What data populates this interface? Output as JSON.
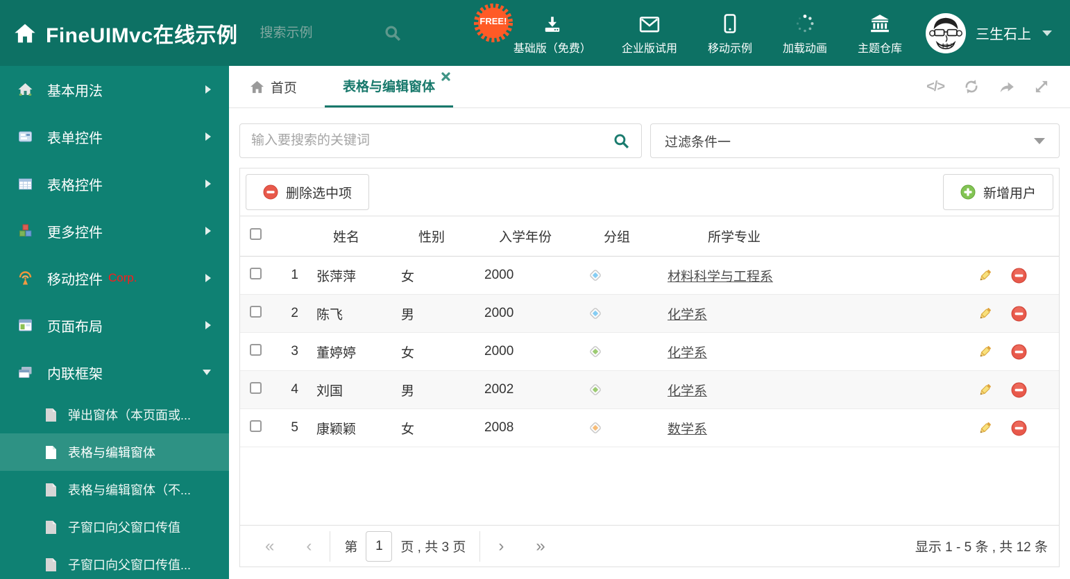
{
  "header": {
    "title": "FineUIMvc在线示例",
    "search_placeholder": "搜索示例",
    "free_badge": "FREE!",
    "nav": [
      {
        "label": "基础版（免费）",
        "icon": "download-icon"
      },
      {
        "label": "企业版试用",
        "icon": "envelope-icon"
      },
      {
        "label": "移动示例",
        "icon": "mobile-icon"
      },
      {
        "label": "加载动画",
        "icon": "spinner-icon"
      },
      {
        "label": "主题仓库",
        "icon": "bank-icon"
      }
    ],
    "user_name": "三生石上"
  },
  "sidebar": {
    "items": [
      {
        "label": "基本用法",
        "icon": "house-icon"
      },
      {
        "label": "表单控件",
        "icon": "form-icon"
      },
      {
        "label": "表格控件",
        "icon": "table-icon"
      },
      {
        "label": "更多控件",
        "icon": "cubes-icon"
      },
      {
        "label": "移动控件",
        "badge": "Corp.",
        "icon": "antenna-icon"
      },
      {
        "label": "页面布局",
        "icon": "layout-icon"
      },
      {
        "label": "内联框架",
        "icon": "frames-icon",
        "expanded": true
      }
    ],
    "subitems": [
      {
        "label": "弹出窗体（本页面或..."
      },
      {
        "label": "表格与编辑窗体",
        "selected": true
      },
      {
        "label": "表格与编辑窗体（不..."
      },
      {
        "label": "子窗口向父窗口传值"
      },
      {
        "label": "子窗口向父窗口传值..."
      }
    ]
  },
  "main": {
    "tabs": [
      {
        "label": "首页",
        "icon": "home-icon"
      },
      {
        "label": "表格与编辑窗体",
        "active": true,
        "closable": true
      }
    ],
    "filter": {
      "search_placeholder": "输入要搜索的关键词",
      "value": "过滤条件一"
    },
    "toolbar": {
      "delete_label": "删除选中项",
      "add_label": "新增用户"
    },
    "table": {
      "columns": [
        "姓名",
        "性别",
        "入学年份",
        "分组",
        "所学专业"
      ],
      "rows": [
        {
          "num": "1",
          "name": "张萍萍",
          "gender": "女",
          "year": "2000",
          "tag_color": "#86cdf3",
          "major": "材料科学与工程系"
        },
        {
          "num": "2",
          "name": "陈飞",
          "gender": "男",
          "year": "2000",
          "tag_color": "#86cdf3",
          "major": "化学系"
        },
        {
          "num": "3",
          "name": "董婷婷",
          "gender": "女",
          "year": "2000",
          "tag_color": "#9ccb72",
          "major": "化学系"
        },
        {
          "num": "4",
          "name": "刘国",
          "gender": "男",
          "year": "2002",
          "tag_color": "#9ccb72",
          "major": "化学系"
        },
        {
          "num": "5",
          "name": "康颖颖",
          "gender": "女",
          "year": "2008",
          "tag_color": "#f7bc77",
          "major": "数学系"
        }
      ]
    },
    "pagination": {
      "page_prefix": "第",
      "page_value": "1",
      "page_suffix": "页 , 共 3 页",
      "summary": "显示 1 - 5 条 , 共 12 条"
    }
  },
  "colors": {
    "header_bg": "#0d7164",
    "sidebar_bg": "#0f8173",
    "accent": "#17786b",
    "free_badge": "#ff5a26",
    "delete_red": "#e8594b",
    "add_green": "#83c454"
  }
}
